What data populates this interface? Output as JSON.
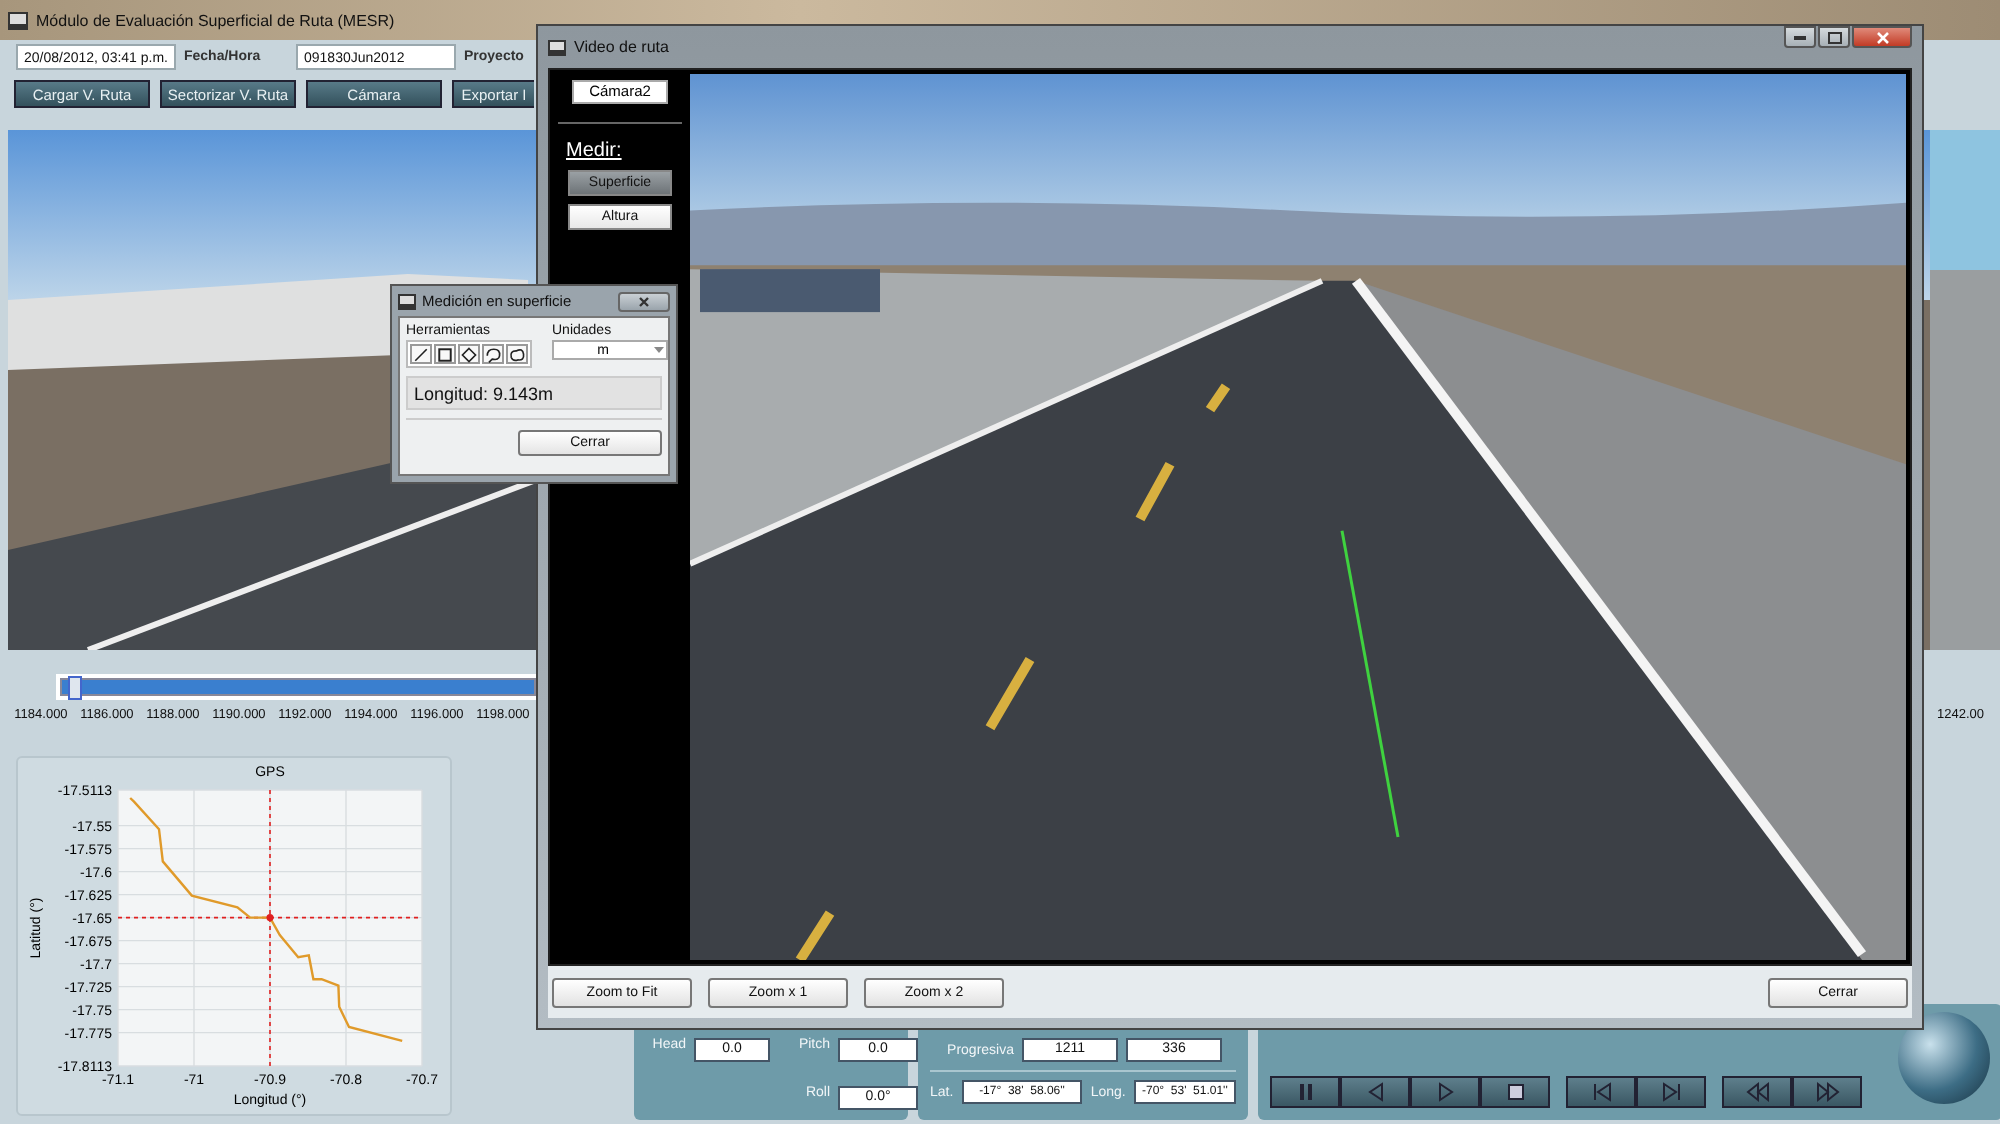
{
  "main_window": {
    "title": "Módulo de Evaluación Superficial de Ruta (MESR)",
    "header_items": [
      {
        "kind": "field",
        "text": "20/08/2012, 03:41 p.m."
      },
      {
        "kind": "caption",
        "text": "Fecha/Hora"
      },
      {
        "kind": "field",
        "text": "091830Jun2012"
      },
      {
        "kind": "caption",
        "text": "Proyecto"
      }
    ],
    "buttons": [
      "Cargar V. Ruta",
      "Sectorizar V. Ruta",
      "Cámara",
      "Exportar I"
    ],
    "timeline": {
      "level": 0.003,
      "ticks": [
        "1184.000",
        "1186.000",
        "1188.000",
        "1190.000",
        "1192.000",
        "1194.000",
        "1196.000",
        "1198.000"
      ],
      "end_tick": "1242.00"
    },
    "gps_chart": {
      "chart_data": {
        "type": "line",
        "title": "GPS",
        "xlabel": "Longitud (°)",
        "ylabel": "Latitud (°)",
        "x": [
          -71.084,
          -71.079,
          -71.046,
          -71.041,
          -71.003,
          -70.943,
          -70.926,
          -70.9,
          -70.887,
          -70.863,
          -70.849,
          -70.843,
          -70.832,
          -70.81,
          -70.809,
          -70.796,
          -70.726
        ],
        "series": [
          {
            "color": "#e09a2a",
            "values": [
              -17.52,
              -17.524,
              -17.554,
              -17.589,
              -17.626,
              -17.639,
              -17.65,
              -17.65,
              -17.669,
              -17.693,
              -17.691,
              -17.717,
              -17.717,
              -17.724,
              -17.747,
              -17.769,
              -17.784
            ]
          },
          {
            "color": "#e02020",
            "marker": "circle",
            "values": [
              null,
              null,
              null,
              null,
              null,
              null,
              null,
              -17.65,
              null,
              null,
              null,
              null,
              null,
              null,
              null,
              null,
              null
            ]
          }
        ],
        "xlim": [
          -71.1,
          -70.7
        ],
        "ylim": [
          -17.8113,
          -17.5113
        ],
        "xticks": [
          -71.1,
          -71,
          -70.9,
          -70.8,
          -70.7
        ],
        "yticks": [
          -17.5113,
          -17.55,
          -17.575,
          -17.6,
          -17.625,
          -17.65,
          -17.675,
          -17.7,
          -17.725,
          -17.75,
          -17.775,
          -17.8113
        ],
        "grid": true,
        "ref_lines": [
          {
            "axis": "x",
            "value": -70.9,
            "color": "#e02020"
          },
          {
            "axis": "y",
            "value": -17.65,
            "color": "#e02020"
          }
        ]
      }
    },
    "attitude": [
      {
        "label": "Head",
        "value": "0.0"
      },
      {
        "label": "Pitch",
        "value": "0.0"
      },
      {
        "label": "Roll",
        "value": "0.0°"
      }
    ],
    "progresiva": {
      "label": "Progresiva",
      "values": [
        "1211",
        "336"
      ]
    },
    "coordinates": [
      {
        "label": "Lat.",
        "value": "-17°  38'  58.06''"
      },
      {
        "label": "Long.",
        "value": "-70°  53'  51.01''"
      }
    ],
    "playback_groups": [
      {
        "buttons": [
          {
            "kind": "pause"
          },
          {
            "kind": "step_back"
          },
          {
            "kind": "play"
          },
          {
            "kind": "stop"
          }
        ]
      },
      {
        "buttons": [
          {
            "kind": "skip_back"
          },
          {
            "kind": "skip_forward"
          }
        ]
      },
      {
        "buttons": [
          {
            "kind": "rewind"
          },
          {
            "kind": "fast_forward"
          }
        ]
      }
    ]
  },
  "measure_dialog": {
    "title": "Medición en superficie",
    "tools_label": "Herramientas",
    "tools": [
      {
        "kind": "line"
      },
      {
        "kind": "rectangle"
      },
      {
        "kind": "diamond"
      },
      {
        "kind": "lasso"
      },
      {
        "kind": "cloud"
      }
    ],
    "units_label": "Unidades",
    "units": "m",
    "readout": "Longitud: 9.143m",
    "close_button": "Cerrar"
  },
  "video_window": {
    "title": "Video de ruta",
    "camera": "Cámara2",
    "measure_label": "Medir:",
    "measure_modes": [
      {
        "label": "Superficie",
        "selected": true
      },
      {
        "label": "Altura",
        "selected": false
      }
    ],
    "zoom_buttons": [
      "Zoom to Fit",
      "Zoom x 1",
      "Zoom x 2"
    ],
    "close_button": "Cerrar"
  }
}
